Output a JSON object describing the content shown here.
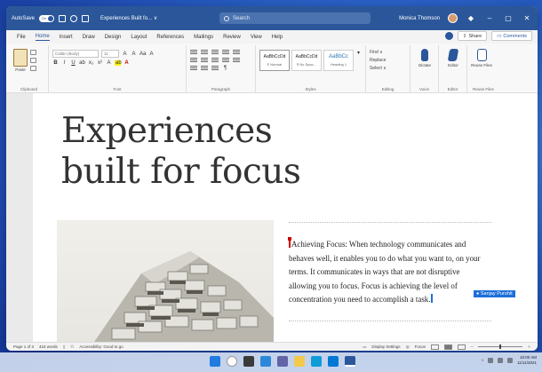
{
  "titlebar": {
    "autosave_label": "AutoSave",
    "autosave_state": "On",
    "doc_title": "Experiences Built fo... ∨",
    "search_placeholder": "Search",
    "user_name": "Monica Thomson"
  },
  "tabs": [
    "File",
    "Home",
    "Insert",
    "Draw",
    "Design",
    "Layout",
    "References",
    "Mailings",
    "Review",
    "View",
    "Help"
  ],
  "active_tab": "Home",
  "share_label": "Share",
  "comments_label": "Comments",
  "ribbon": {
    "clipboard": {
      "paste_label": "Paste",
      "group_label": "Clipboard"
    },
    "font": {
      "font_name": "Calibri (Body)",
      "font_size": "11",
      "group_label": "Font"
    },
    "paragraph": {
      "group_label": "Paragraph"
    },
    "styles": {
      "items": [
        {
          "sample": "AaBbCcDd",
          "name": "¶ Normal"
        },
        {
          "sample": "AaBbCcDd",
          "name": "¶ No Spac..."
        },
        {
          "sample": "AaBbCc",
          "name": "Heading 1"
        }
      ],
      "group_label": "Styles"
    },
    "editing": {
      "find": "Find ∨",
      "replace": "Replace",
      "select": "Select ∨",
      "group_label": "Editing"
    },
    "voice": {
      "dictate": "Dictate",
      "group_label": "Voice"
    },
    "editor": {
      "editor": "Editor",
      "group_label": "Editor"
    },
    "reuse": {
      "reuse": "Reuse Files",
      "group_label": "Reuse Files"
    }
  },
  "document": {
    "heading_line1": "Experiences",
    "heading_line2": "built for focus",
    "body": "Achieving Focus: When technology communicates and behaves well, it enables you to do what you want to, on your terms. It communicates in ways that are not disruptive allowing you to focus. Focus is achieving the level of concentration you need to accomplish a task.",
    "coauthor": "Sanjay Purohit"
  },
  "statusbar": {
    "page_info": "Page 1 of 3",
    "words": "424 words",
    "accessibility": "Accessibility: Good to go",
    "display_settings": "Display Settings",
    "focus": "Focus"
  },
  "clock": {
    "time": "10:00 AM",
    "date": "11/11/2021"
  },
  "colors": {
    "accent": "#2b579a",
    "coauthor": "#1e6fd9",
    "cursor": "#d00000"
  }
}
